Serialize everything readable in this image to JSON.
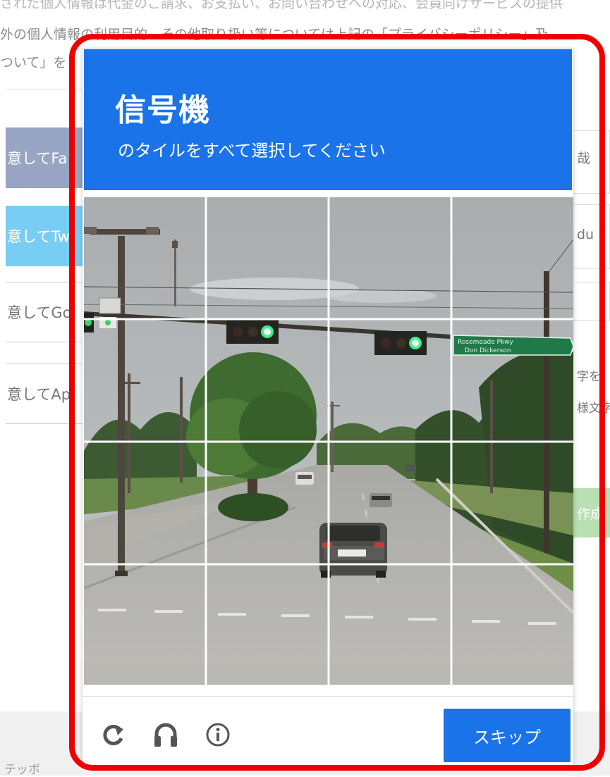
{
  "background": {
    "text_lines": [
      "されだ個人情報は代金のご請求、お支払い、お問い合わせへの対応、会員向けサービスの提供",
      "外の個人情報の利用目的、その他取り扱い等については上記の「プライバシーポリシー」及",
      "ついて」を"
    ],
    "buttons": [
      {
        "label": "意してFa"
      },
      {
        "label": "意してTw"
      },
      {
        "label": "意してGo"
      },
      {
        "label": "意してAp"
      }
    ],
    "right_texts": [
      "哉",
      "du",
      "字を",
      "様文字",
      "作成"
    ],
    "footer_text": "テッボ"
  },
  "captcha": {
    "title": "信号機",
    "subtitle": "のタイルをすべて選択してください",
    "grid": {
      "rows": 4,
      "cols": 4
    },
    "tiles": [
      {
        "label": "tile-1-1"
      },
      {
        "label": "tile-1-2"
      },
      {
        "label": "tile-1-3"
      },
      {
        "label": "tile-1-4"
      },
      {
        "label": "tile-2-1"
      },
      {
        "label": "tile-2-2"
      },
      {
        "label": "tile-2-3"
      },
      {
        "label": "tile-2-4"
      },
      {
        "label": "tile-3-1"
      },
      {
        "label": "tile-3-2"
      },
      {
        "label": "tile-3-3"
      },
      {
        "label": "tile-3-4"
      },
      {
        "label": "tile-4-1"
      },
      {
        "label": "tile-4-2"
      },
      {
        "label": "tile-4-3"
      },
      {
        "label": "tile-4-4"
      }
    ],
    "footer_icons": [
      "reload-icon",
      "headphones-icon",
      "info-icon"
    ],
    "skip_label": "スキップ",
    "street_sign_text": "Rosemeade Pkwy / Don Dickerson"
  },
  "colors": {
    "header_blue": "#1a73e8",
    "highlight_red": "#ee0000",
    "facebook_btn": "#97a4c3",
    "twitter_btn": "#78cef2",
    "create_btn_green": "#b8e0b3"
  }
}
